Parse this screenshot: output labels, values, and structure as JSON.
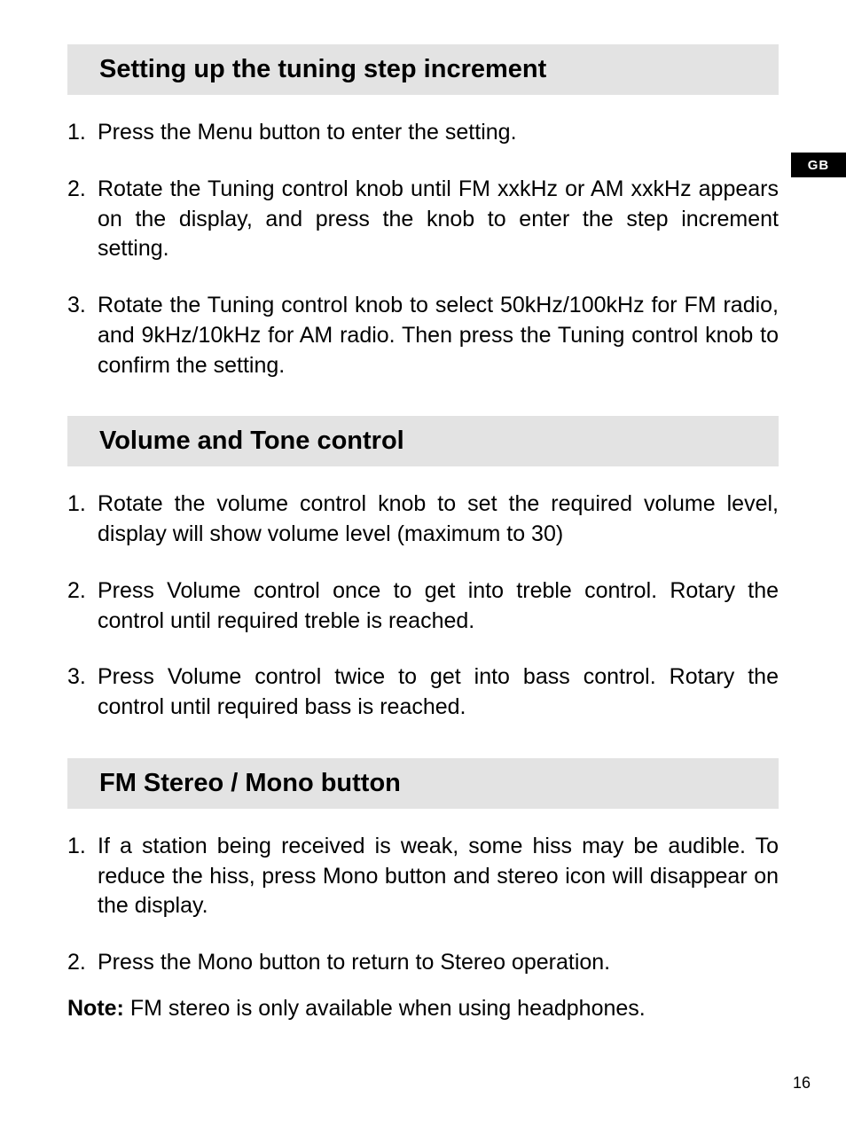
{
  "lang_tab": "GB",
  "page_number": "16",
  "sections": [
    {
      "heading": "Setting up the tuning step increment",
      "items": [
        "Press the Menu button to enter the setting.",
        "Rotate the Tuning control knob until FM xxkHz or AM xxkHz appears on the display, and press the knob to enter the step increment setting.",
        "Rotate the Tuning control knob to select 50kHz/100kHz for FM radio, and 9kHz/10kHz for AM radio. Then press the Tuning control knob to confirm the setting."
      ]
    },
    {
      "heading": "Volume and Tone control",
      "items": [
        "Rotate the volume control knob to set the required volume level, display will show volume level (maximum to 30)",
        "Press Volume control once to get into treble control. Rotary the control until required treble is reached.",
        "Press Volume control twice to get into bass control. Rotary the control until required bass is reached."
      ]
    },
    {
      "heading": "FM Stereo / Mono button",
      "items": [
        "If a station being received is weak, some hiss may be audible. To reduce the hiss, press Mono button and stereo icon will disappear on the display.",
        "Press the Mono button to return to Stereo operation."
      ]
    }
  ],
  "note_label": "Note:",
  "note_text": " FM stereo is only available when using headphones."
}
